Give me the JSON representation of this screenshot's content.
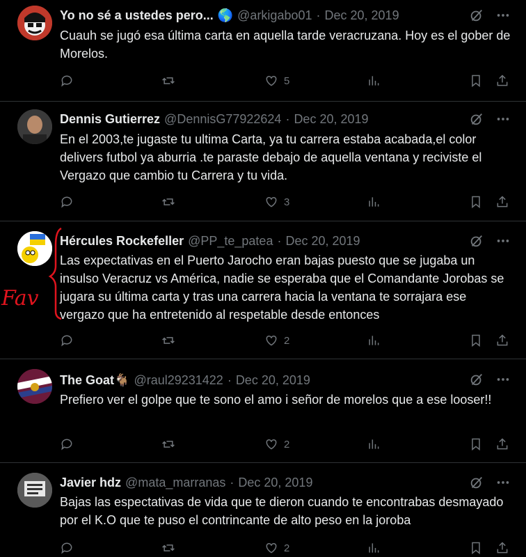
{
  "tweets": [
    {
      "name": "Yo no sé a ustedes pero...",
      "emoji": "🌎",
      "handle": "@arkigabo01",
      "separator": "·",
      "date": "Dec 20, 2019",
      "text": "Cuauh se jugó esa última carta en aquella tarde veracruzana. Hoy es el gober de Morelos.",
      "likes": "5",
      "avatar_color": "#c0392b"
    },
    {
      "name": "Dennis Gutierrez",
      "handle": "@DennisG77922624",
      "separator": "·",
      "date": "Dec 20, 2019",
      "text": "En el 2003,te jugaste tu ultima Carta, ya tu carrera estaba acabada,el color delivers futbol ya aburria .te paraste debajo de aquella ventana y reciviste el Vergazo que cambio tu Carrera y tu vida.",
      "likes": "3",
      "avatar_color": "#444444"
    },
    {
      "name": "Hércules Rockefeller",
      "handle": "@PP_te_patea",
      "separator": "·",
      "date": "Dec 20, 2019",
      "text": "Las expectativas en el Puerto Jarocho eran bajas puesto que se jugaba un insulso Veracruz vs América, nadie se esperaba que el Comandante Jorobas se jugara su última carta y tras una carrera hacia la ventana te sorrajara ese vergazo que ha entretenido al respetable desde entonces",
      "likes": "2",
      "avatar_color": "#ffffff"
    },
    {
      "name": "The Goat",
      "emoji": "🐐",
      "handle": "@raul29231422",
      "separator": "·",
      "date": "Dec 20, 2019",
      "text": "Prefiero ver el golpe que te sono el amo i señor de morelos que a ese looser!!",
      "likes": "2",
      "avatar_color": "#8b1a3a"
    },
    {
      "name": "Javier hdz",
      "handle": "@mata_marranas",
      "separator": "·",
      "date": "Dec 20, 2019",
      "text": "Bajas las espectativas de vida que te dieron cuando te encontrabas desmayado por el K.O que te puso el contrincante de alto peso en la joroba",
      "likes": "2",
      "avatar_color": "#666666"
    }
  ],
  "annotation": {
    "text": "Fav",
    "color": "#e0141e"
  },
  "colors": {
    "background": "#000000",
    "text": "#e7e9ea",
    "muted": "#71767b",
    "border": "#2f3336"
  },
  "icons": [
    "reply-icon",
    "retweet-icon",
    "like-icon",
    "views-icon",
    "bookmark-icon",
    "share-icon",
    "grok-icon",
    "more-icon"
  ]
}
